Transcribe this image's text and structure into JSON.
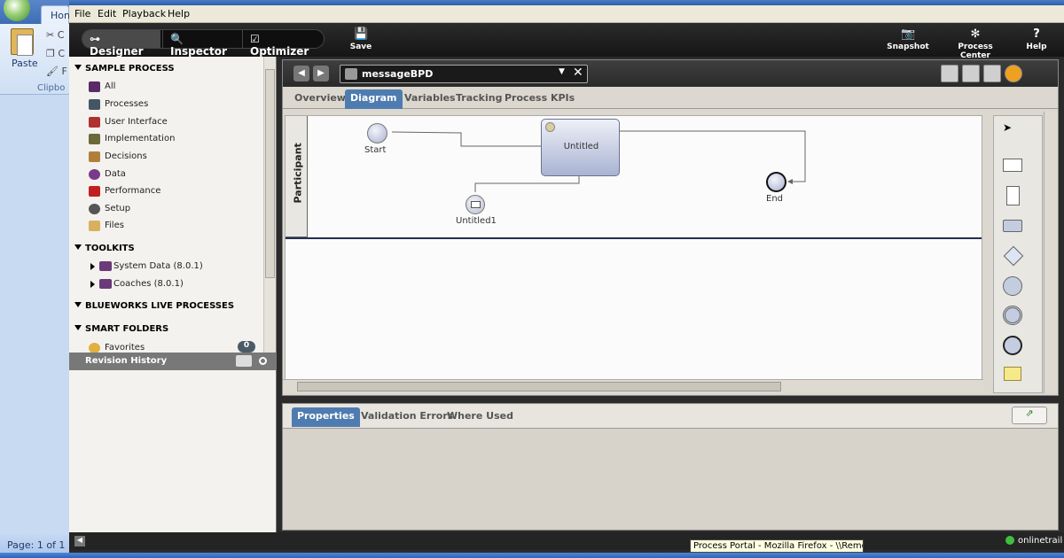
{
  "word": {
    "home_tab": "Hon",
    "paste_label": "Paste",
    "cut_label": "C",
    "copy_label": "C",
    "format_label": "F",
    "clipboard_label": "Clipbo",
    "status": "Page: 1 of 1"
  },
  "menu": [
    "File",
    "Edit",
    "Playback",
    "Help"
  ],
  "modes": [
    "Designer",
    "Inspector",
    "Optimizer"
  ],
  "toolbar": {
    "save": "Save",
    "snapshot": "Snapshot",
    "process_center": "Process Center",
    "help": "Help"
  },
  "sidebar": {
    "section_sample": "SAMPLE PROCESS",
    "items": [
      {
        "label": "All",
        "color": "#5a2a6a"
      },
      {
        "label": "Processes",
        "color": "#445566"
      },
      {
        "label": "User Interface",
        "color": "#b03030"
      },
      {
        "label": "Implementation",
        "color": "#6a6a3a"
      },
      {
        "label": "Decisions",
        "color": "#b0803a"
      },
      {
        "label": "Data",
        "color": "#7a3a8a"
      },
      {
        "label": "Performance",
        "color": "#c02020"
      },
      {
        "label": "Setup",
        "color": "#555555"
      },
      {
        "label": "Files",
        "color": "#d9b060"
      }
    ],
    "section_toolkits": "TOOLKITS",
    "toolkits": [
      "System Data (8.0.1)",
      "Coaches (8.0.1)"
    ],
    "section_blueworks": "BLUEWORKS LIVE PROCESSES",
    "section_smart": "SMART FOLDERS",
    "favorites": "Favorites",
    "favorites_count": "0",
    "revision_history": "Revision History"
  },
  "editor": {
    "bpd_name": "messageBPD",
    "tabs": [
      "Overview",
      "Diagram",
      "Variables",
      "Tracking",
      "Process KPIs"
    ],
    "active_tab": "Diagram",
    "lane_label": "Participant",
    "nodes": {
      "start": "Start",
      "task": "Untitled",
      "message": "Untitled1",
      "end": "End"
    }
  },
  "properties": {
    "tabs": [
      "Properties",
      "Validation Errors",
      "Where Used"
    ],
    "active_tab": "Properties"
  },
  "status": {
    "online": "onlinetrail",
    "tooltip": "Process Portal - Mozilla Firefox - \\\\Remote"
  }
}
